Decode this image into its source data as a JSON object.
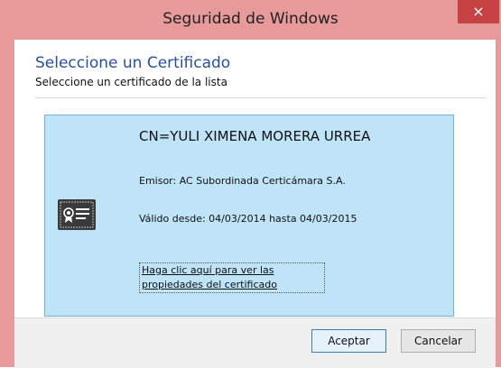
{
  "window": {
    "title": "Seguridad de Windows",
    "close_glyph": "×"
  },
  "dialog": {
    "heading": "Seleccione un Certificado",
    "subheading": "Seleccione un certificado de la lista"
  },
  "certificate": {
    "icon": "certificate-icon",
    "cn": "CN=YULI XIMENA MORERA URREA",
    "issuer": "Emisor: AC Subordinada Certicámara S.A.",
    "validity": "Válido desde: 04/03/2014 hasta 04/03/2015",
    "properties_link": "Haga clic aquí para ver las propiedades del certificado"
  },
  "buttons": {
    "accept": "Aceptar",
    "cancel": "Cancelar"
  },
  "colors": {
    "titlebar": "#e89a9a",
    "close": "#c74343",
    "heading": "#2a4f9a",
    "card_bg": "#bfe3f7",
    "card_border": "#6fb3de"
  }
}
